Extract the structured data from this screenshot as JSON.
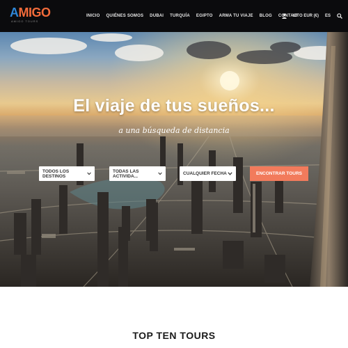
{
  "brand": {
    "name": "AMIGO",
    "tagline": "AMIGO TOURS",
    "accent": "#f26b3a",
    "accent_secondary": "#2e86d6"
  },
  "nav": {
    "items": [
      {
        "label": "INICIO"
      },
      {
        "label": "QUIÉNES SOMOS"
      },
      {
        "label": "DUBAI"
      },
      {
        "label": "TURQUÍA"
      },
      {
        "label": "EGIPTO"
      },
      {
        "label": "ARMA TU VIAJE"
      },
      {
        "label": "BLOG"
      },
      {
        "label": "CONTACTO"
      }
    ],
    "cart_icon": "user-icon",
    "cart_amount": "¥0",
    "currency": "EUR (€)",
    "language": "ES",
    "search_icon": "search-icon"
  },
  "hero": {
    "title": "El viaje de tus sueños...",
    "subtitle": "a una búsqueda de distancia",
    "search": {
      "destination": "TODOS LOS DESTINOS",
      "activity": "TODAS LAS ACTIVIDA...",
      "date": "CUALQUIER FECHA",
      "submit_label": "ENCONTRAR TOURS",
      "submit_color": "#f27b5c"
    }
  },
  "section": {
    "title": "TOP TEN TOURS"
  }
}
